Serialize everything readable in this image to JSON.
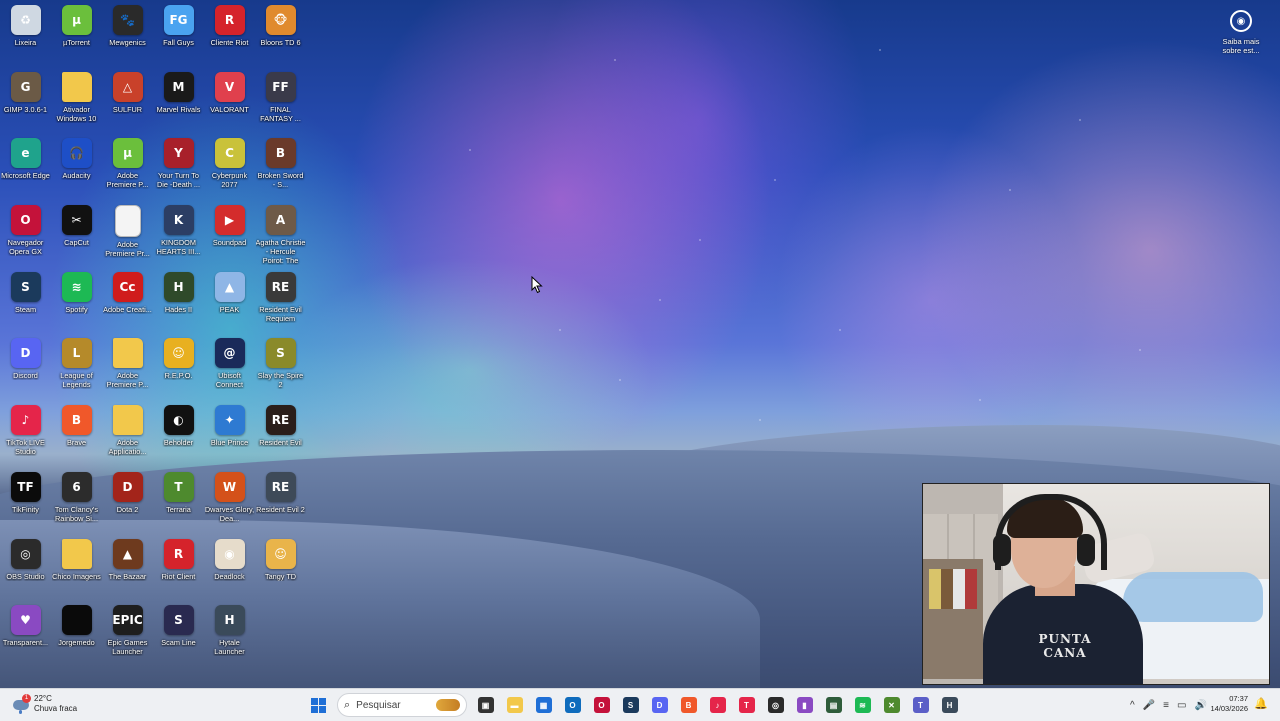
{
  "desktop": {
    "icons": [
      {
        "label": "Lixeira",
        "icon": "recycle-bin-icon",
        "color": "#cfd8e2",
        "glyph": "♻"
      },
      {
        "label": "µTorrent",
        "icon": "utorrent-icon",
        "color": "#6bbf3c",
        "glyph": "µ"
      },
      {
        "label": "Mewgenics",
        "icon": "mewgenics-icon",
        "color": "#2a2a2a",
        "glyph": "🐾"
      },
      {
        "label": "Fall Guys",
        "icon": "fall-guys-icon",
        "color": "#4aa3f0",
        "glyph": "FG"
      },
      {
        "label": "Cliente Riot",
        "icon": "riot-client-icon",
        "color": "#d5232b",
        "glyph": "R"
      },
      {
        "label": "Bloons TD 6",
        "icon": "bloons-td6-icon",
        "color": "#e08a2e",
        "glyph": "🐵"
      },
      {
        "label": "GIMP 3.0.6-1",
        "icon": "gimp-icon",
        "color": "#6b5a46",
        "glyph": "G"
      },
      {
        "label": "Ativador Windows 10",
        "icon": "folder-icon",
        "color": "#f2c84b",
        "glyph": ""
      },
      {
        "label": "SULFUR",
        "icon": "sulfur-icon",
        "color": "#c9412a",
        "glyph": "△"
      },
      {
        "label": "Marvel Rivals",
        "icon": "marvel-rivals-icon",
        "color": "#1a1a1a",
        "glyph": "M"
      },
      {
        "label": "VALORANT",
        "icon": "valorant-icon",
        "color": "#e0404d",
        "glyph": "V"
      },
      {
        "label": "FINAL FANTASY ...",
        "icon": "final-fantasy-icon",
        "color": "#3a3a4a",
        "glyph": "FF"
      },
      {
        "label": "Microsoft Edge",
        "icon": "edge-icon",
        "color": "#1fa38c",
        "glyph": "e"
      },
      {
        "label": "Audacity",
        "icon": "audacity-icon",
        "color": "#1e4fc7",
        "glyph": "🎧"
      },
      {
        "label": "Adobe Premiere P...",
        "icon": "utorrent-icon",
        "color": "#6bbf3c",
        "glyph": "µ"
      },
      {
        "label": "Your Turn To Die -Death ...",
        "icon": "your-turn-to-die-icon",
        "color": "#a8202a",
        "glyph": "Y"
      },
      {
        "label": "Cyberpunk 2077",
        "icon": "cyberpunk-icon",
        "color": "#c9c23a",
        "glyph": "C"
      },
      {
        "label": "Broken Sword - S...",
        "icon": "broken-sword-icon",
        "color": "#6a3a2a",
        "glyph": "B"
      },
      {
        "label": "Navegador Opera GX",
        "icon": "opera-gx-icon",
        "color": "#c4123a",
        "glyph": "O"
      },
      {
        "label": "CapCut",
        "icon": "capcut-icon",
        "color": "#111111",
        "glyph": "✂"
      },
      {
        "label": "Adobe Premiere Pr...",
        "icon": "file-icon",
        "color": "#f4f4f4",
        "glyph": ""
      },
      {
        "label": "KINGDOM HEARTS III...",
        "icon": "kingdom-hearts-icon",
        "color": "#2c3e64",
        "glyph": "K"
      },
      {
        "label": "Soundpad",
        "icon": "soundpad-icon",
        "color": "#d42c2c",
        "glyph": "▶"
      },
      {
        "label": "Agatha Christie - Hercule Poirot: The London Case",
        "icon": "agatha-christie-icon",
        "color": "#6e5a48",
        "glyph": "A"
      },
      {
        "label": "Steam",
        "icon": "steam-icon",
        "color": "#1b3a5c",
        "glyph": "S"
      },
      {
        "label": "Spotify",
        "icon": "spotify-icon",
        "color": "#1db954",
        "glyph": "≋"
      },
      {
        "label": "Adobe Creati...",
        "icon": "adobe-cc-icon",
        "color": "#d01c1c",
        "glyph": "Cc"
      },
      {
        "label": "Hades II",
        "icon": "hades-ii-icon",
        "color": "#2f4a2a",
        "glyph": "H"
      },
      {
        "label": "PEAK",
        "icon": "peak-icon",
        "color": "#8fb6e6",
        "glyph": "▲"
      },
      {
        "label": "Resident Evil Requiem",
        "icon": "resident-evil-requiem-icon",
        "color": "#3a3a3a",
        "glyph": "RE"
      },
      {
        "label": "Discord",
        "icon": "discord-icon",
        "color": "#5865f2",
        "glyph": "D"
      },
      {
        "label": "League of Legends",
        "icon": "league-of-legends-icon",
        "color": "#b58a2a",
        "glyph": "L"
      },
      {
        "label": "Adobe Premiere P...",
        "icon": "folder-icon",
        "color": "#f2c84b",
        "glyph": ""
      },
      {
        "label": "R.E.P.O.",
        "icon": "repo-icon",
        "color": "#e8b020",
        "glyph": "☺"
      },
      {
        "label": "Ubisoft Connect",
        "icon": "ubisoft-icon",
        "color": "#1a2a5a",
        "glyph": "@"
      },
      {
        "label": "Slay the Spire 2",
        "icon": "slay-the-spire-icon",
        "color": "#8a8a2a",
        "glyph": "S"
      },
      {
        "label": "TikTok LIVE Studio",
        "icon": "tiktok-live-icon",
        "color": "#e5254a",
        "glyph": "♪"
      },
      {
        "label": "Brave",
        "icon": "brave-icon",
        "color": "#f0582a",
        "glyph": "B"
      },
      {
        "label": "Adobe Applicatio...",
        "icon": "folder-icon",
        "color": "#f2c84b",
        "glyph": ""
      },
      {
        "label": "Beholder",
        "icon": "beholder-icon",
        "color": "#111111",
        "glyph": "◐"
      },
      {
        "label": "Blue Prince",
        "icon": "blue-prince-icon",
        "color": "#2e7ad2",
        "glyph": "✦"
      },
      {
        "label": "Resident Evil",
        "icon": "resident-evil-icon",
        "color": "#2a1e1a",
        "glyph": "RE"
      },
      {
        "label": "TikFinity",
        "icon": "tikfinity-icon",
        "color": "#0b0b0b",
        "glyph": "TF"
      },
      {
        "label": "Tom Clancy's Rainbow Si...",
        "icon": "rainbow-six-icon",
        "color": "#2c2c2c",
        "glyph": "6"
      },
      {
        "label": "Dota 2",
        "icon": "dota2-icon",
        "color": "#a3241a",
        "glyph": "D"
      },
      {
        "label": "Terraria",
        "icon": "terraria-icon",
        "color": "#4e8a2e",
        "glyph": "T"
      },
      {
        "label": "Dwarves Glory, Dea...",
        "icon": "dwarves-icon",
        "color": "#d4511a",
        "glyph": "W"
      },
      {
        "label": "Resident Evil 2",
        "icon": "resident-evil-2-icon",
        "color": "#3e4a58",
        "glyph": "RE"
      },
      {
        "label": "OBS Studio",
        "icon": "obs-icon",
        "color": "#2b2b2b",
        "glyph": "◎"
      },
      {
        "label": "Chico Imagens",
        "icon": "folder-icon",
        "color": "#f2c84b",
        "glyph": ""
      },
      {
        "label": "The Bazaar",
        "icon": "the-bazaar-icon",
        "color": "#6e3a1e",
        "glyph": "▲"
      },
      {
        "label": "Riot Client",
        "icon": "riot-client-icon",
        "color": "#d5232b",
        "glyph": "R"
      },
      {
        "label": "Deadlock",
        "icon": "deadlock-icon",
        "color": "#e6dccb",
        "glyph": "◉"
      },
      {
        "label": "Tangy TD",
        "icon": "tangy-td-icon",
        "color": "#e9b44a",
        "glyph": "☺"
      },
      {
        "label": "Transparent...",
        "icon": "transparent-icon",
        "color": "#8a4ac2",
        "glyph": "♥"
      },
      {
        "label": "Jorgemedo",
        "icon": "jorgemedo-icon",
        "color": "#0a0a0a",
        "glyph": ""
      },
      {
        "label": "Epic Games Launcher",
        "icon": "epic-games-icon",
        "color": "#1e1e1e",
        "glyph": "EPIC"
      },
      {
        "label": "Scam Line",
        "icon": "scam-line-icon",
        "color": "#2a2a50",
        "glyph": "S"
      },
      {
        "label": "Hytale Launcher",
        "icon": "hytale-icon",
        "color": "#3a4a5a",
        "glyph": "H"
      }
    ],
    "saiba_mais": "Saiba mais sobre est..."
  },
  "webcam": {
    "shirt_text": "PUNTA CANA"
  },
  "taskbar": {
    "weather": {
      "temp": "22°C",
      "condition": "Chuva fraca",
      "badge": "1"
    },
    "search_placeholder": "Pesquisar",
    "apps": [
      {
        "name": "task-view-icon",
        "color": "#333333",
        "glyph": "▣"
      },
      {
        "name": "file-explorer-icon",
        "color": "#f2c84b",
        "glyph": "▬"
      },
      {
        "name": "microsoft-store-icon",
        "color": "#1f6fd6",
        "glyph": "▦"
      },
      {
        "name": "outlook-icon",
        "color": "#0f6cbd",
        "glyph": "O"
      },
      {
        "name": "opera-gx-icon",
        "color": "#c4123a",
        "glyph": "O"
      },
      {
        "name": "steam-icon",
        "color": "#1b3a5c",
        "glyph": "S"
      },
      {
        "name": "discord-icon",
        "color": "#5865f2",
        "glyph": "D"
      },
      {
        "name": "brave-icon",
        "color": "#f0582a",
        "glyph": "B"
      },
      {
        "name": "tiktok-live-icon",
        "color": "#e5254a",
        "glyph": "♪"
      },
      {
        "name": "tikfinity-icon",
        "color": "#e5254a",
        "glyph": "T"
      },
      {
        "name": "obs-icon",
        "color": "#2b2b2b",
        "glyph": "◎"
      },
      {
        "name": "twitch-studio-icon",
        "color": "#8a4ac2",
        "glyph": "▮"
      },
      {
        "name": "notepad-icon",
        "color": "#2e5c3a",
        "glyph": "▤"
      },
      {
        "name": "spotify-icon",
        "color": "#1db954",
        "glyph": "≋"
      },
      {
        "name": "minecraft-icon",
        "color": "#4e8a2e",
        "glyph": "✕"
      },
      {
        "name": "teams-icon",
        "color": "#5b5fc7",
        "glyph": "T"
      },
      {
        "name": "hytale-icon",
        "color": "#3a4a5a",
        "glyph": "H"
      }
    ],
    "tray": {
      "chevron": "^",
      "mic": "🎤",
      "sound_settings": "≡",
      "network": "▭",
      "volume": "🔊",
      "battery": "▯"
    },
    "clock": {
      "time": "07:37",
      "date": "14/03/2026"
    },
    "notifications": "🔔"
  }
}
